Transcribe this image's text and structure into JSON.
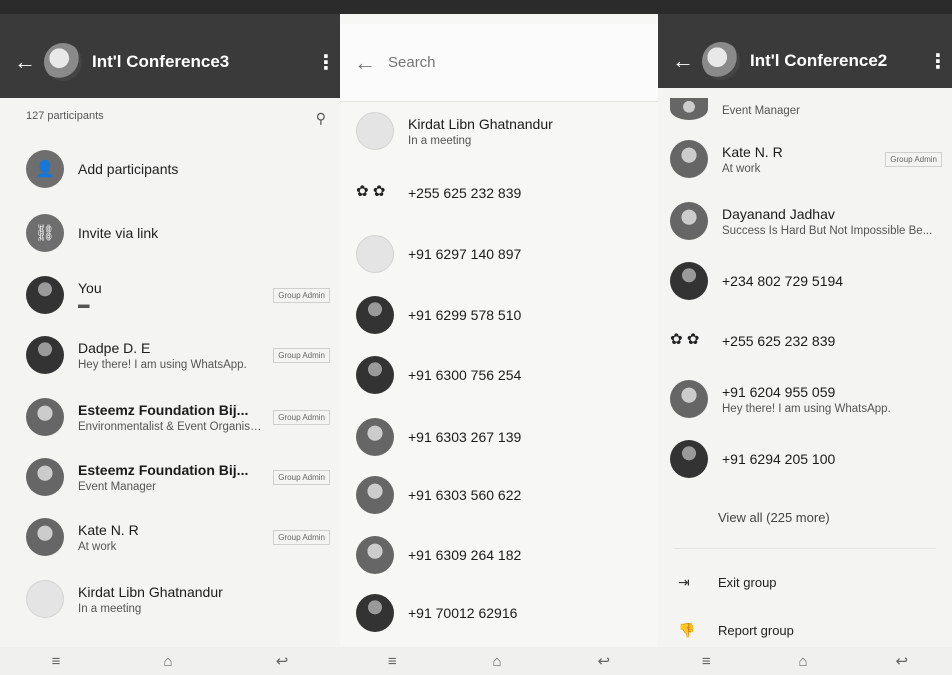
{
  "screen1": {
    "title": "Int'l Conference3",
    "participants_count": "127 participants",
    "add_participants": "Add participants",
    "invite_link": "Invite via link",
    "members": [
      {
        "name": "You",
        "status": "",
        "admin": true
      },
      {
        "name": "Dadpe D. E",
        "status": "Hey there! I am using WhatsApp.",
        "admin": true
      },
      {
        "name": "Esteemz Foundation Bij...",
        "status": "Environmentalist & Event Organiser/ Ev...",
        "admin": true
      },
      {
        "name": "Esteemz Foundation Bij...",
        "status": "Event Manager",
        "admin": true
      },
      {
        "name": "Kate N. R",
        "status": "At work",
        "admin": true
      },
      {
        "name": "Kirdat Libn Ghatnandur",
        "status": "In a meeting",
        "admin": false
      }
    ],
    "admin_label": "Group Admin"
  },
  "screen2": {
    "search_placeholder": "Search",
    "contacts": [
      {
        "name": "Kirdat Libn Ghatnandur",
        "status": "In a meeting"
      },
      {
        "name": "+255 625 232 839",
        "status": ""
      },
      {
        "name": "+91 6297 140 897",
        "status": ""
      },
      {
        "name": "+91 6299 578 510",
        "status": ""
      },
      {
        "name": "+91 6300 756 254",
        "status": ""
      },
      {
        "name": "+91 6303 267 139",
        "status": ""
      },
      {
        "name": "+91 6303 560 622",
        "status": ""
      },
      {
        "name": "+91 6309 264 182",
        "status": ""
      },
      {
        "name": "+91 70012 62916",
        "status": ""
      }
    ]
  },
  "screen3": {
    "title": "Int'l Conference2",
    "partial_top_status": "Event Manager",
    "members": [
      {
        "name": "Kate N. R",
        "status": "At work",
        "admin": true
      },
      {
        "name": "Dayanand Jadhav",
        "status": "Success Is Hard But Not Impossible Be...",
        "admin": false
      },
      {
        "name": "+234 802 729 5194",
        "status": "",
        "admin": false
      },
      {
        "name": "+255 625 232 839",
        "status": "",
        "admin": false
      },
      {
        "name": "+91 6204 955 059",
        "status": "Hey there! I am using WhatsApp.",
        "admin": false
      },
      {
        "name": "+91 6294 205 100",
        "status": "",
        "admin": false
      }
    ],
    "admin_label": "Group Admin",
    "view_all": "View all (225 more)",
    "exit_group": "Exit group",
    "report_group": "Report group"
  },
  "icons": {
    "back": "back-arrow-icon",
    "menu": "more-vert-icon",
    "search": "search-icon",
    "nav_menu": "menu-icon",
    "nav_home": "home-icon",
    "nav_back": "back-icon"
  }
}
